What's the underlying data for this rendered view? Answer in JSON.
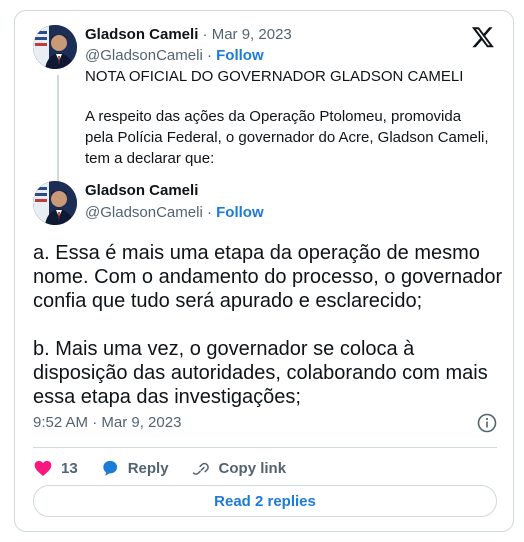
{
  "tweet1": {
    "name": "Gladson Cameli",
    "date": "· Mar 9, 2023",
    "handle": "@GladsonCameli",
    "dot": "·",
    "follow": "Follow",
    "line1": "NOTA OFICIAL DO GOVERNADOR GLADSON CAMELI",
    "line2": "A respeito das ações da Operação Ptolomeu, promovida",
    "line3": "pela Polícia Federal, o governador do Acre, Gladson Cameli,",
    "line4": "tem a declarar que:"
  },
  "tweet2": {
    "name": "Gladson Cameli",
    "handle": "@GladsonCameli",
    "dot": "·",
    "follow": "Follow",
    "p1": [
      "a. Essa é mais uma etapa da operação de mesmo",
      "nome. Com o andamento do processo, o governador",
      "confia que tudo será apurado e esclarecido;"
    ],
    "p2": [
      "b. Mais uma vez, o governador se coloca à",
      "disposição das autoridades, colaborando com mais",
      "essa etapa das investigações;"
    ]
  },
  "meta": {
    "time": "9:52 AM · Mar 9, 2023"
  },
  "actions": {
    "likes": "13",
    "reply": "Reply",
    "copy": "Copy link"
  },
  "read_replies": "Read 2 replies",
  "icons": [
    "x-logo-icon",
    "info-icon",
    "heart-icon",
    "reply-bubble-icon",
    "link-icon"
  ],
  "colors": {
    "accent": "#1d7bd8",
    "like": "#f91880",
    "muted": "#536471",
    "border": "#cfd9de"
  }
}
